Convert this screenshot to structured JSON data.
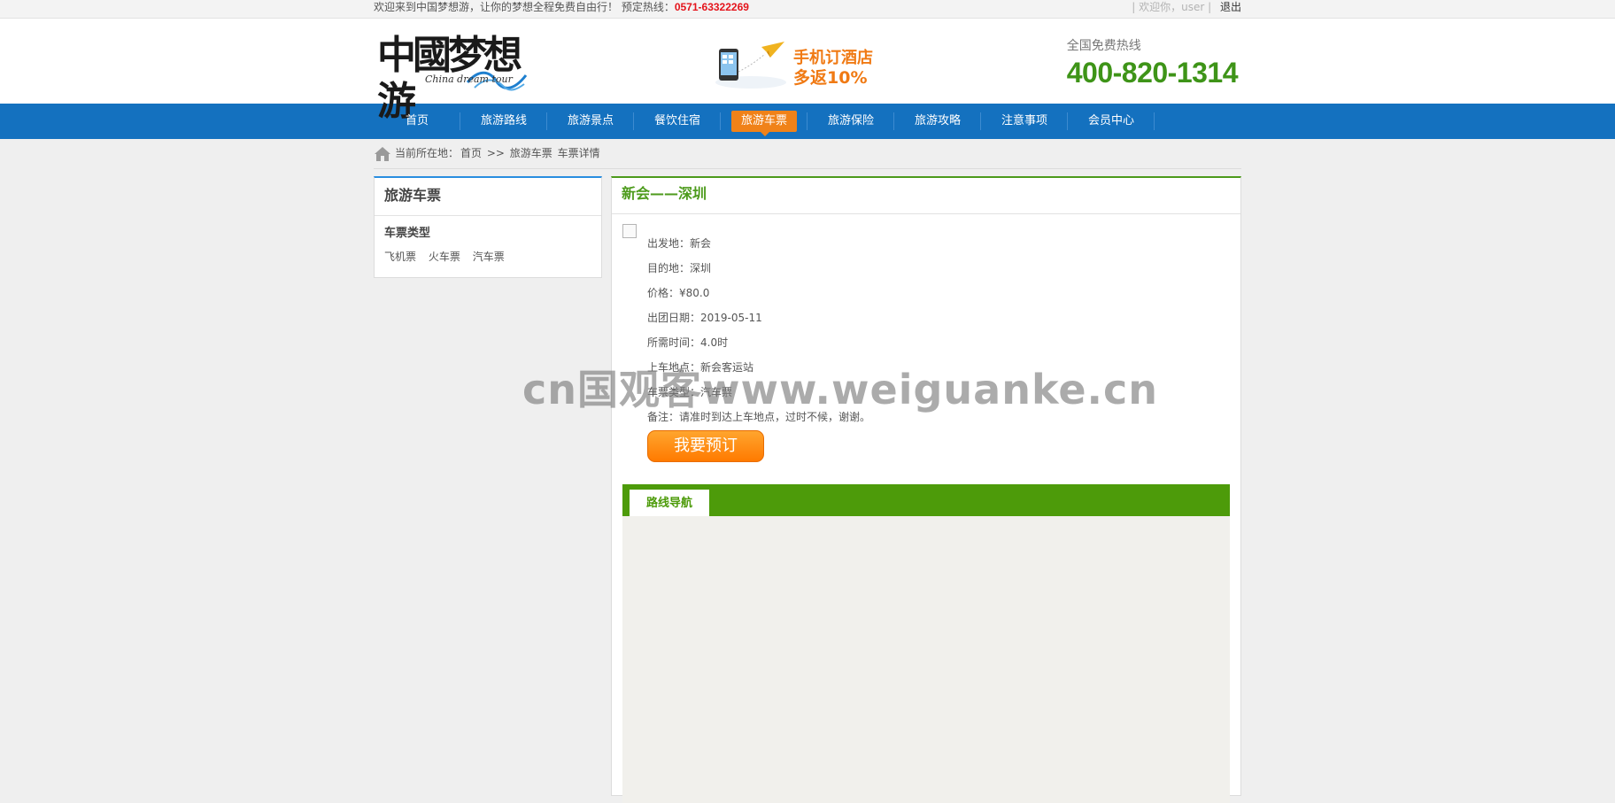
{
  "topbar": {
    "welcome": "欢迎来到中国梦想游，让你的梦想全程免费自由行！ 预定热线：",
    "hotline": "0571-63322269",
    "sep_left": "|",
    "hello": "欢迎你，user",
    "sep_right": "|",
    "logout": "退出"
  },
  "header": {
    "logo_cn": "中國梦想游",
    "logo_en": "China dream tour",
    "promo_line1": "手机订酒店",
    "promo_line2": "多返10%",
    "tel_label": "全国免费热线",
    "tel_number": "400-820-1314"
  },
  "nav": {
    "items": [
      {
        "label": "首页"
      },
      {
        "label": "旅游路线"
      },
      {
        "label": "旅游景点"
      },
      {
        "label": "餐饮住宿"
      },
      {
        "label": "旅游车票"
      },
      {
        "label": "旅游保险"
      },
      {
        "label": "旅游攻略"
      },
      {
        "label": "注意事项"
      },
      {
        "label": "会员中心"
      }
    ],
    "active_index": 4
  },
  "breadcrumb": {
    "prefix": "当前所在地：",
    "home": "首页",
    "arrow": ">>",
    "section": "旅游车票",
    "page": "车票详情"
  },
  "sidebar": {
    "title": "旅游车票",
    "subtitle": "车票类型",
    "links": [
      "飞机票",
      "火车票",
      "汽车票"
    ]
  },
  "detail": {
    "title": "新会——深圳",
    "rows": [
      "出发地：新会",
      "目的地：深圳",
      "价格：¥80.0",
      "出团日期：2019-05-11",
      "所需时间：4.0时",
      "上车地点：新会客运站",
      "车票类型：汽车票",
      "备注：请准时到达上车地点，过时不候，谢谢。"
    ],
    "book_button": "我要预订"
  },
  "route_nav": {
    "tab": "路线导航"
  },
  "watermark": "cn国观客www.weiguanke.cn",
  "colors": {
    "nav_blue": "#1471bf",
    "active_orange": "#f08219",
    "green": "#4d9b1c",
    "hotline_red": "#e4141b"
  }
}
